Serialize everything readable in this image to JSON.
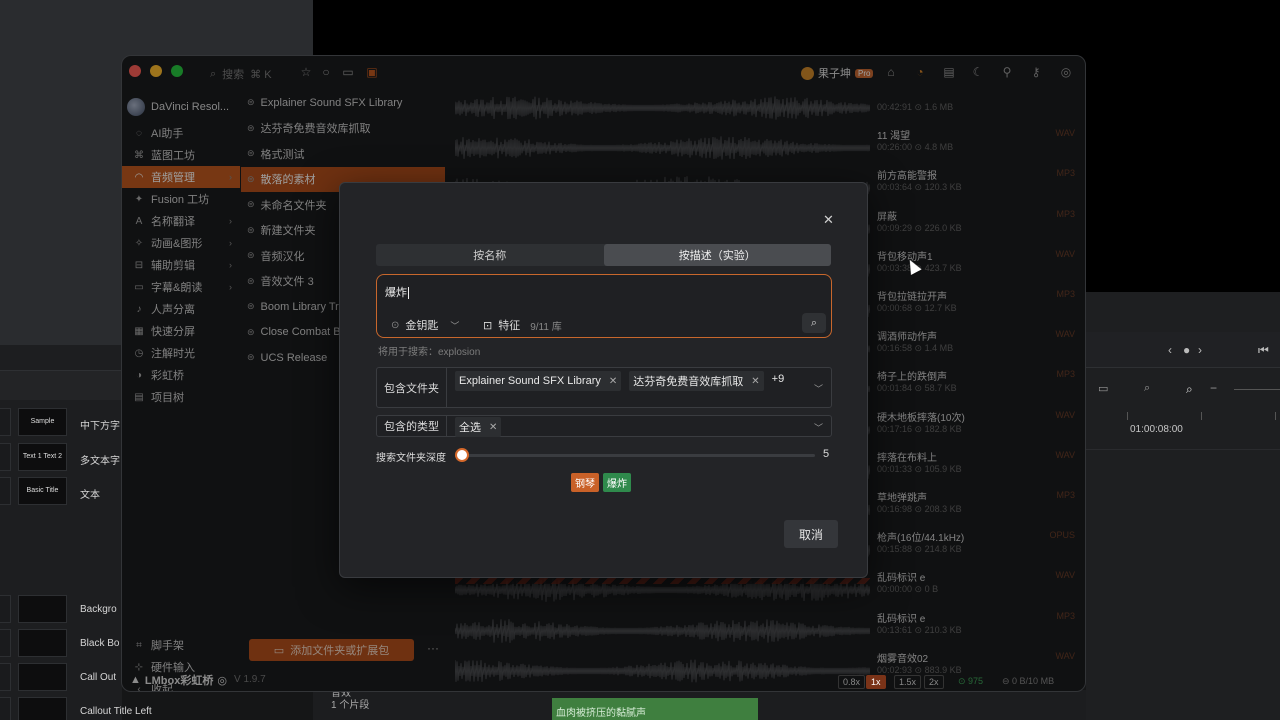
{
  "titlebar": {
    "search_label": "搜索",
    "search_shortcut": "⌘ K",
    "user_name": "果子坤",
    "user_badge": "Pro"
  },
  "sidebar": {
    "app_name": "DaVinci Resol...",
    "items": [
      {
        "label": "AI助手",
        "icon": "chat-icon"
      },
      {
        "label": "蓝图工坊",
        "icon": "blueprint-icon"
      },
      {
        "label": "音频管理",
        "icon": "headphones-icon",
        "active": true
      },
      {
        "label": "Fusion 工坊",
        "icon": "fusion-icon"
      },
      {
        "label": "名称翻译",
        "icon": "translate-icon"
      },
      {
        "label": "动画&图形",
        "icon": "animation-icon"
      },
      {
        "label": "辅助剪辑",
        "icon": "edit-icon"
      },
      {
        "label": "字幕&朗读",
        "icon": "subtitle-icon"
      },
      {
        "label": "人声分离",
        "icon": "voice-icon"
      },
      {
        "label": "快速分屏",
        "icon": "grid-icon"
      },
      {
        "label": "注解时光",
        "icon": "clock-icon"
      },
      {
        "label": "彩虹桥",
        "icon": "rainbow-icon"
      },
      {
        "label": "项目树",
        "icon": "tree-icon"
      }
    ],
    "bottom_items": [
      {
        "label": "脚手架",
        "icon": "scaffold-icon"
      },
      {
        "label": "硬件输入",
        "icon": "hardware-icon"
      },
      {
        "label": "收起",
        "icon": "collapse-icon"
      }
    ],
    "footer_brand": "LMbox彩虹桥",
    "version": "V 1.9.7"
  },
  "folders": {
    "items": [
      "Explainer Sound SFX Library",
      "达芬奇免费音效库抓取",
      "格式测试",
      "散落的素材",
      "未命名文件夹",
      "新建文件夹",
      "音频汉化",
      "音效文件 3",
      "Boom Library Tra...",
      "Close Combat Bo...",
      "UCS Release"
    ],
    "active_index": 3,
    "add_button": "添加文件夹或扩展包"
  },
  "files": [
    {
      "name": "",
      "meta": "00:42:91 ⊙ 1.6 MB",
      "ext": ""
    },
    {
      "name": "11 渴望",
      "meta": "00:26:00 ⊙ 4.8 MB",
      "ext": "WAV"
    },
    {
      "name": "前方高能警报",
      "meta": "00:03:64 ⊙ 120.3 KB",
      "ext": "MP3"
    },
    {
      "name": "屏蔽",
      "meta": "00:09:29 ⊙ 226.0 KB",
      "ext": "MP3"
    },
    {
      "name": "背包移动声1",
      "meta": "00:03:38 ⊙ 423.7 KB",
      "ext": "WAV"
    },
    {
      "name": "背包拉链拉开声",
      "meta": "00:00:68 ⊙ 12.7 KB",
      "ext": "MP3"
    },
    {
      "name": "调酒师动作声",
      "meta": "00:16:58 ⊙ 1.4 MB",
      "ext": "WAV"
    },
    {
      "name": "椅子上的跌倒声",
      "meta": "00:01:84 ⊙ 58.7 KB",
      "ext": "MP3"
    },
    {
      "name": "硬木地板摔落(10次)",
      "meta": "00:17:16 ⊙ 182.8 KB",
      "ext": "WAV"
    },
    {
      "name": "摔落在布料上",
      "meta": "00:01:33 ⊙ 105.9 KB",
      "ext": "WAV"
    },
    {
      "name": "草地弹跳声",
      "meta": "00:16:98 ⊙ 208.3 KB",
      "ext": "MP3"
    },
    {
      "name": "枪声(16位/44.1kHz)",
      "meta": "00:15:88 ⊙ 214.8 KB",
      "ext": "OPUS"
    },
    {
      "name": "乱码标识 e",
      "meta": "00:00:00 ⊙ 0 B",
      "ext": "WAV"
    },
    {
      "name": "乱码标识 e",
      "meta": "00:13:61 ⊙ 210.3 KB",
      "ext": "MP3"
    },
    {
      "name": "烟雾音效02",
      "meta": "00:02:93 ⊙ 883.9 KB",
      "ext": "WAV"
    }
  ],
  "statusbar": {
    "speeds": [
      "0.8x",
      "1x",
      "1.5x",
      "2x"
    ],
    "active_speed_index": 1,
    "count": "975",
    "storage": "0 B/10 MB"
  },
  "modal": {
    "tabs": [
      "按名称",
      "按描述（实验）"
    ],
    "active_tab_index": 1,
    "query": "爆炸",
    "key_label": "金钥匙",
    "feature_label": "特征",
    "feature_count": "9/11 库",
    "hint": "将用于搜索：explosion",
    "include_folders_label": "包含文件夹",
    "folder_tags": [
      "Explainer Sound SFX Library",
      "达芬奇免费音效库抓取"
    ],
    "folder_more": "+9",
    "include_types_label": "包含的类型",
    "type_tags": [
      "全选"
    ],
    "depth_label": "搜索文件夹深度",
    "depth_value": 5,
    "depth_max": 10,
    "depth_display": "5",
    "chips": [
      {
        "label": "钢琴",
        "color": "#c96128"
      },
      {
        "label": "爆炸",
        "color": "#2f8a4c"
      }
    ],
    "cancel_button": "取消"
  },
  "background": {
    "timecode": "01:00:08:00",
    "left_rows": [
      {
        "thumb": "Sample",
        "label": "中下方字"
      },
      {
        "thumb": "Text 1 Text 2",
        "label": "多文本字"
      },
      {
        "thumb": "Basic Title",
        "label": "文本"
      },
      {
        "thumb": "",
        "label": "Backgro"
      },
      {
        "thumb": "",
        "label": "Black Bo"
      },
      {
        "thumb": "",
        "label": "Call Out"
      },
      {
        "thumb": "",
        "label": "Callout Title Left"
      }
    ],
    "clip_name": "血肉被挤压的黏腻声",
    "track_label": "音效",
    "track_count": "1 个片段"
  },
  "colors": {
    "accent": "#c15a1f",
    "window_bg": "#1b1c1e",
    "modal_bg": "#232427"
  }
}
